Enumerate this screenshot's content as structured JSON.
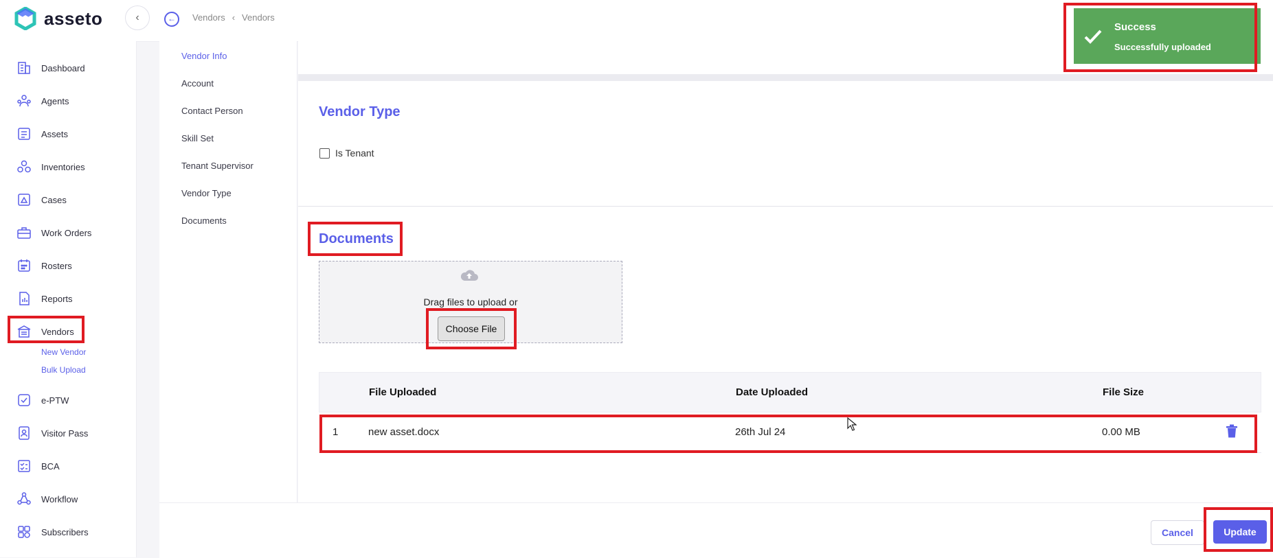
{
  "app": {
    "name": "asseto"
  },
  "topbar": {
    "breadcrumb": [
      "Vendors",
      "Vendors"
    ]
  },
  "sidebar": {
    "items": [
      {
        "label": "Dashboard",
        "icon": "building-icon"
      },
      {
        "label": "Agents",
        "icon": "agents-icon"
      },
      {
        "label": "Assets",
        "icon": "assets-icon"
      },
      {
        "label": "Inventories",
        "icon": "inventories-icon"
      },
      {
        "label": "Cases",
        "icon": "cases-icon"
      },
      {
        "label": "Work Orders",
        "icon": "briefcase-icon"
      },
      {
        "label": "Rosters",
        "icon": "calendar-icon"
      },
      {
        "label": "Reports",
        "icon": "report-icon"
      },
      {
        "label": "Vendors",
        "icon": "vendor-store-icon"
      },
      {
        "label": "e-PTW",
        "icon": "eptw-icon"
      },
      {
        "label": "Visitor Pass",
        "icon": "visitor-pass-icon"
      },
      {
        "label": "BCA",
        "icon": "checklist-icon"
      },
      {
        "label": "Workflow",
        "icon": "workflow-icon"
      },
      {
        "label": "Subscribers",
        "icon": "subscribers-icon"
      }
    ],
    "vendor_subitems": [
      "New Vendor",
      "Bulk Upload"
    ]
  },
  "section_nav": [
    "Vendor Info",
    "Account",
    "Contact Person",
    "Skill Set",
    "Tenant Supervisor",
    "Vendor Type",
    "Documents"
  ],
  "vendor_type": {
    "title": "Vendor Type",
    "checkbox_label": "Is Tenant",
    "checked": false
  },
  "documents": {
    "title": "Documents",
    "drop_text": "Drag files to upload or",
    "choose_file": "Choose File",
    "table": {
      "headers": [
        "File Uploaded",
        "Date Uploaded",
        "File Size"
      ],
      "rows": [
        {
          "index": "1",
          "file": "new asset.docx",
          "date": "26th Jul 24",
          "size": "0.00 MB"
        }
      ]
    }
  },
  "footer": {
    "cancel": "Cancel",
    "update": "Update"
  },
  "toast": {
    "title": "Success",
    "message": "Successfully uploaded"
  },
  "colors": {
    "accent": "#5a5fe8",
    "success": "#5aa75a",
    "highlight": "#e01b22"
  }
}
